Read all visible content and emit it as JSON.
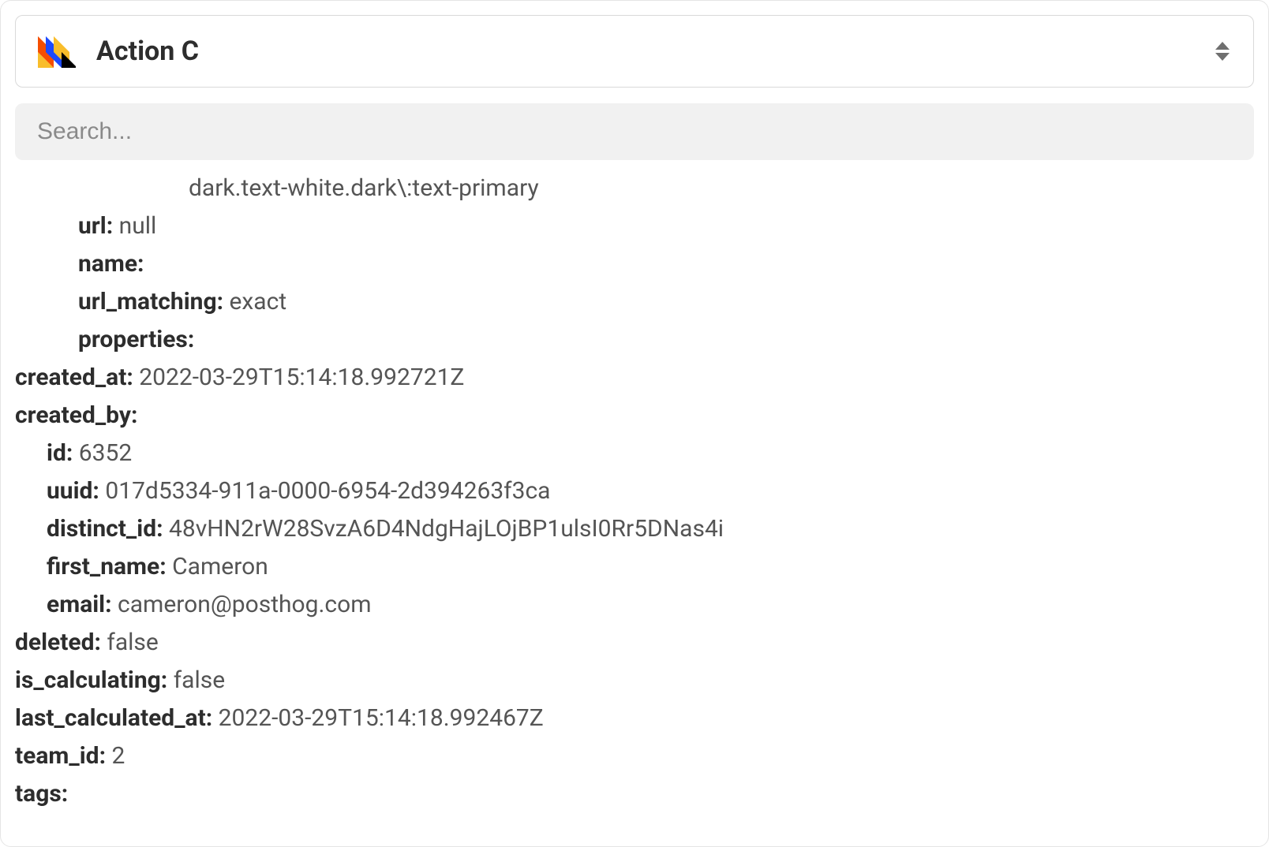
{
  "selector": {
    "label": "Action C"
  },
  "search": {
    "placeholder": "Search..."
  },
  "overflow_selector": "dark.text-white.dark\\:text-primary",
  "fields": {
    "url": {
      "label": "url:",
      "value": "null"
    },
    "name": {
      "label": "name:",
      "value": ""
    },
    "url_matching": {
      "label": "url_matching:",
      "value": "exact"
    },
    "properties": {
      "label": "properties:",
      "value": ""
    },
    "created_at": {
      "label": "created_at:",
      "value": "2022-03-29T15:14:18.992721Z"
    },
    "created_by": {
      "label": "created_by:"
    },
    "cb_id": {
      "label": "id:",
      "value": "6352"
    },
    "cb_uuid": {
      "label": "uuid:",
      "value": "017d5334-911a-0000-6954-2d394263f3ca"
    },
    "cb_distinct_id": {
      "label": "distinct_id:",
      "value": "48vHN2rW28SvzA6D4NdgHajLOjBP1ulsI0Rr5DNas4i"
    },
    "cb_first_name": {
      "label": "first_name:",
      "value": "Cameron"
    },
    "cb_email": {
      "label": "email:",
      "value": "cameron@posthog.com"
    },
    "deleted": {
      "label": "deleted:",
      "value": "false"
    },
    "is_calculating": {
      "label": "is_calculating:",
      "value": "false"
    },
    "last_calculated_at": {
      "label": "last_calculated_at:",
      "value": "2022-03-29T15:14:18.992467Z"
    },
    "team_id": {
      "label": "team_id:",
      "value": "2"
    },
    "tags": {
      "label": "tags:",
      "value": ""
    }
  }
}
